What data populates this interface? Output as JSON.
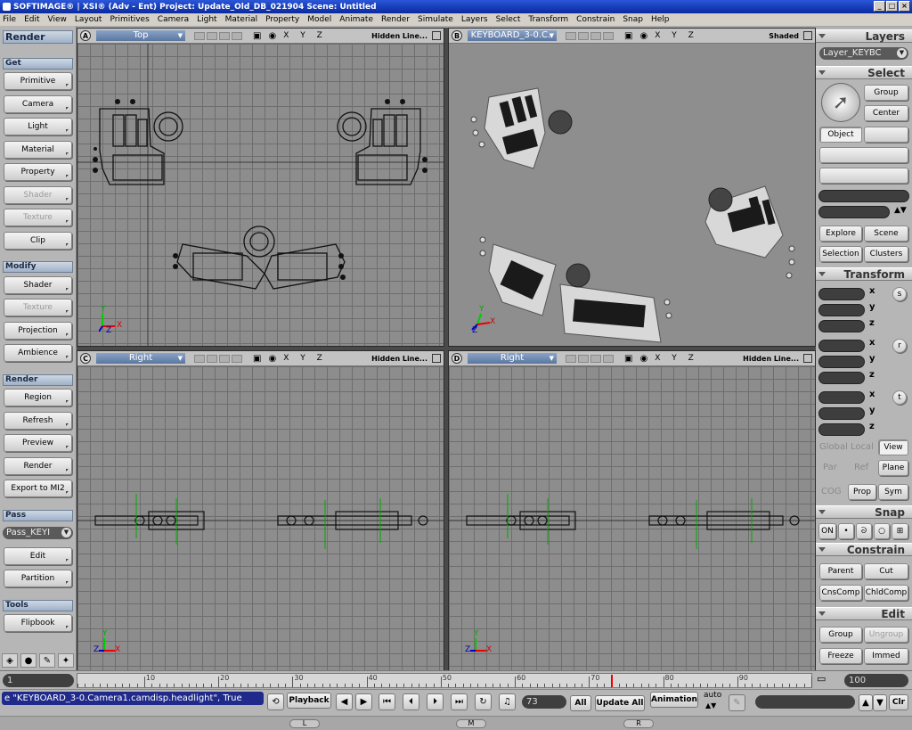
{
  "window": {
    "title": "SOFTIMAGE® | XSI® (Adv - Ent) Project: Update_Old_DB_021904   Scene: Untitled"
  },
  "menu": [
    "File",
    "Edit",
    "View",
    "Layout",
    "Primitives",
    "Camera",
    "Light",
    "Material",
    "Property",
    "Model",
    "Animate",
    "Render",
    "Simulate",
    "Layers",
    "Select",
    "Transform",
    "Constrain",
    "Snap",
    "Help"
  ],
  "left": {
    "header": "Render",
    "get": "Get",
    "get_items": [
      "Primitive",
      "Camera",
      "Light",
      "Material",
      "Property",
      "Shader",
      "Texture",
      "Clip"
    ],
    "modify": "Modify",
    "modify_items": [
      "Shader",
      "Texture",
      "Projection",
      "Ambience"
    ],
    "render": "Render",
    "render_items": [
      "Region",
      "Refresh",
      "Preview",
      "Render",
      "Export to MI2"
    ],
    "pass": "Pass",
    "pass_select": "Pass_KEYI",
    "pass_items": [
      "Edit",
      "Partition"
    ],
    "tools": "Tools",
    "tools_items": [
      "Flipbook"
    ]
  },
  "viewports": [
    {
      "letter": "A",
      "camera": "Top",
      "xyz": "X Y Z",
      "mode": "Hidden Line..."
    },
    {
      "letter": "B",
      "camera": "KEYBOARD_3-0.C..",
      "xyz": "X Y Z",
      "mode": "Shaded"
    },
    {
      "letter": "C",
      "camera": "Right",
      "xyz": "X Y Z",
      "mode": "Hidden Line..."
    },
    {
      "letter": "D",
      "camera": "Right",
      "xyz": "X Y Z",
      "mode": "Hidden Line..."
    }
  ],
  "axis": {
    "x": "X",
    "y": "Y",
    "z": "Z"
  },
  "right": {
    "layers": "Layers",
    "layer_select": "Layer_KEYBC",
    "select": "Select",
    "group": "Group",
    "center": "Center",
    "object": "Object",
    "explore": "Explore",
    "scene": "Scene",
    "selection": "Selection",
    "clusters": "Clusters",
    "transform": "Transform",
    "axes": [
      "x",
      "y",
      "z"
    ],
    "tr_icons": [
      "s",
      "r",
      "t"
    ],
    "global": "Global",
    "local": "Local",
    "view": "View",
    "par": "Par",
    "ref": "Ref",
    "plane": "Plane",
    "cog": "COG",
    "prop": "Prop",
    "sym": "Sym",
    "snap": "Snap",
    "on": "ON",
    "constrain": "Constrain",
    "parent": "Parent",
    "cut": "Cut",
    "cnscomp": "CnsComp",
    "chldcomp": "ChldComp",
    "edit": "Edit",
    "edit_group": "Group",
    "ungroup": "Ungroup",
    "freeze": "Freeze",
    "immed": "Immed"
  },
  "timeline": {
    "start": "1",
    "end": "100",
    "ticks": [
      "10",
      "20",
      "30",
      "40",
      "50",
      "60",
      "70",
      "80",
      "90"
    ],
    "current": 73
  },
  "playbar": {
    "cmd": "e \"KEYBOARD_3-0.Camera1.camdisp.headlight\", True",
    "playback": "Playback",
    "frame": "73",
    "all": "All",
    "update_all": "Update All",
    "animation": "Animation",
    "auto": "auto",
    "clr": "Clr"
  },
  "status": {
    "l": "L",
    "m": "M",
    "r": "R"
  }
}
